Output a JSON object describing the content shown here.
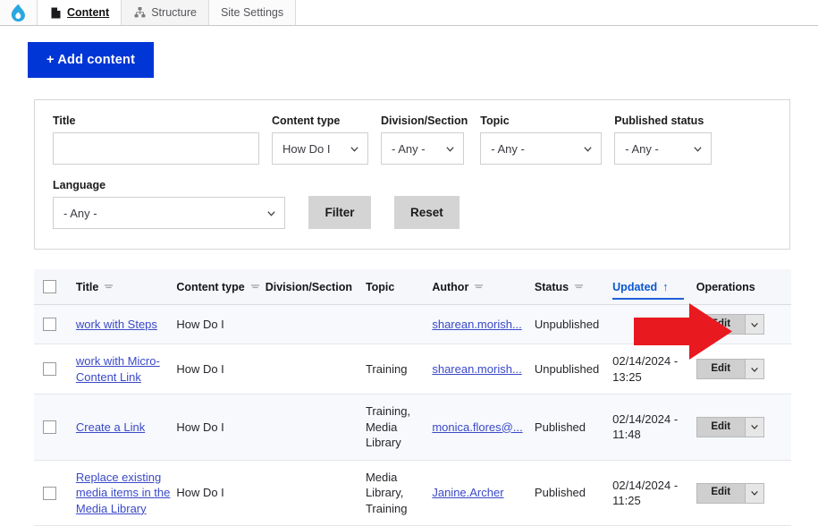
{
  "toolbar": {
    "logo_icon": "drupal-droplet-icon",
    "tabs": [
      {
        "label": "Content",
        "icon": "page-icon",
        "active": true
      },
      {
        "label": "Structure",
        "icon": "hierarchy-icon",
        "active": false
      },
      {
        "label": "Site Settings",
        "icon": "none",
        "active": false
      }
    ]
  },
  "actions": {
    "add_content_label": "+ Add content"
  },
  "filters": {
    "title": {
      "label": "Title",
      "value": "",
      "placeholder": ""
    },
    "content_type": {
      "label": "Content type",
      "value": "How Do I"
    },
    "division_section": {
      "label": "Division/Section",
      "value": "- Any -"
    },
    "topic": {
      "label": "Topic",
      "value": "- Any -"
    },
    "published_status": {
      "label": "Published status",
      "value": "- Any -"
    },
    "language": {
      "label": "Language",
      "value": "- Any -"
    },
    "filter_button": "Filter",
    "reset_button": "Reset"
  },
  "table": {
    "columns": [
      {
        "label": "Title",
        "sortable": true,
        "active": false
      },
      {
        "label": "Content type",
        "sortable": true,
        "active": false
      },
      {
        "label": "Division/Section",
        "sortable": false,
        "active": false
      },
      {
        "label": "Topic",
        "sortable": false,
        "active": false
      },
      {
        "label": "Author",
        "sortable": true,
        "active": false
      },
      {
        "label": "Status",
        "sortable": true,
        "active": false
      },
      {
        "label": "Updated",
        "sortable": true,
        "active": true,
        "sort_direction": "↑"
      },
      {
        "label": "Operations",
        "sortable": false,
        "active": false
      }
    ],
    "rows": [
      {
        "title": "work with Steps",
        "content_type": "How Do I",
        "division_section": "",
        "topic": "",
        "author": "sharean.morish...",
        "status": "Unpublished",
        "updated": "",
        "edit_label": "Edit"
      },
      {
        "title": "work with Micro-Content Link",
        "content_type": "How Do I",
        "division_section": "",
        "topic": "Training",
        "author": "sharean.morish...",
        "status": "Unpublished",
        "updated": "02/14/2024 - 13:25",
        "edit_label": "Edit"
      },
      {
        "title": "Create a Link",
        "content_type": "How Do I",
        "division_section": "",
        "topic": "Training, Media Library",
        "author": "monica.flores@...",
        "status": "Published",
        "updated": "02/14/2024 - 11:48",
        "edit_label": "Edit"
      },
      {
        "title": "Replace existing media items in the Media Library",
        "content_type": "How Do I",
        "division_section": "",
        "topic": "Media Library, Training",
        "author": "Janine.Archer",
        "status": "Published",
        "updated": "02/14/2024 - 11:25",
        "edit_label": "Edit"
      }
    ]
  },
  "annotation": {
    "arrow_icon": "red-right-arrow-annotation",
    "arrow_color": "#e8191f",
    "points_to": "Edit"
  },
  "colors": {
    "brand_blue": "#0036d6",
    "link_blue": "#3a49c8",
    "sort_active_blue": "#1f5fd6",
    "annotation_red": "#e8191f",
    "button_gray": "#d4d4d4"
  }
}
